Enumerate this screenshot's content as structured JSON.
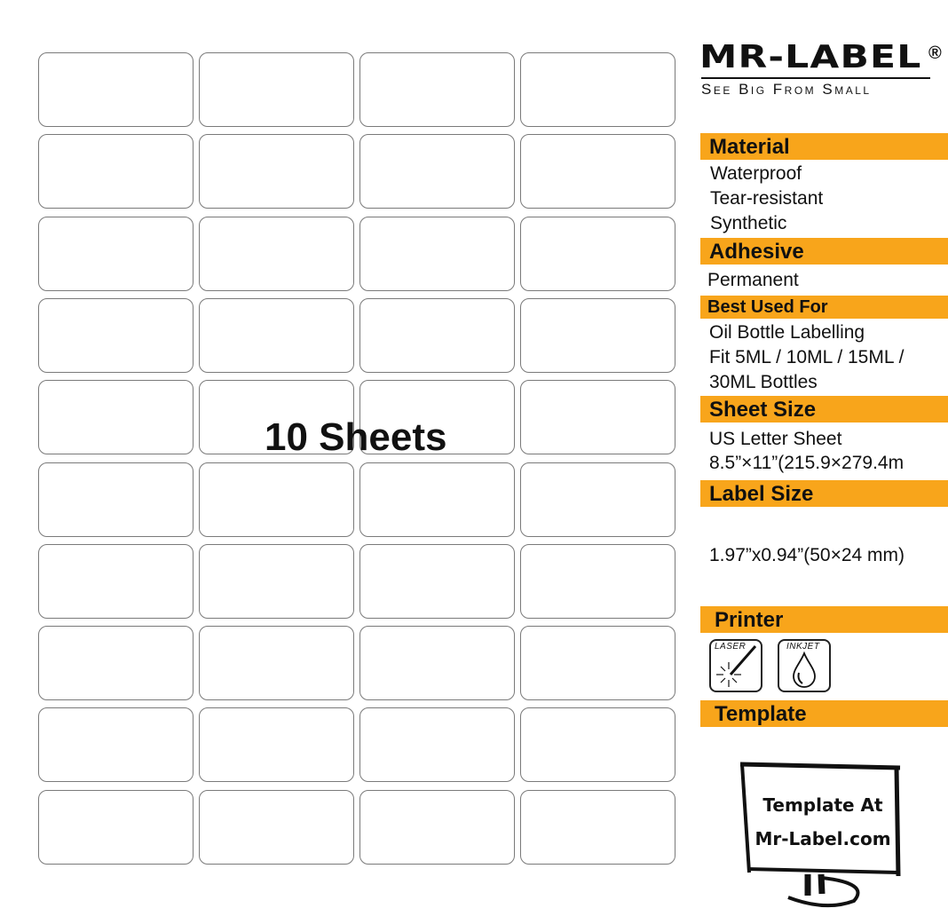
{
  "sheet": {
    "rows": 10,
    "columns": 4,
    "label_count": 40,
    "overlay_text": "10 Sheets"
  },
  "brand": {
    "name": "MR-LABEL",
    "registered_mark": "®",
    "tagline": "See Big From Small"
  },
  "specs": {
    "material": {
      "heading": "Material",
      "items": [
        "Waterproof",
        "Tear-resistant",
        "Synthetic"
      ]
    },
    "adhesive": {
      "heading": "Adhesive",
      "items": [
        "Permanent"
      ]
    },
    "best_used_for": {
      "heading": "Best Used For",
      "items": [
        "Oil Bottle Labelling",
        "Fit 5ML / 10ML / 15ML /",
        "30ML Bottles"
      ]
    },
    "sheet_size": {
      "heading": "Sheet Size",
      "items": [
        "US Letter Sheet",
        "8.5”×11”(215.9×279.4m"
      ]
    },
    "label_size": {
      "heading": "Label Size",
      "items": [
        "1.97”x0.94”(50×24 mm)"
      ]
    },
    "printer": {
      "heading": "Printer",
      "icons": [
        {
          "name": "laser-printer-icon",
          "caption": "LASER"
        },
        {
          "name": "inkjet-printer-icon",
          "caption": "INKJET"
        }
      ]
    },
    "template": {
      "heading": "Template",
      "monitor_lines": [
        "Template At",
        "Mr-Label.com"
      ]
    }
  },
  "colors": {
    "accent": "#F8A51B",
    "label_border": "#7a7a7a",
    "text": "#111111"
  }
}
